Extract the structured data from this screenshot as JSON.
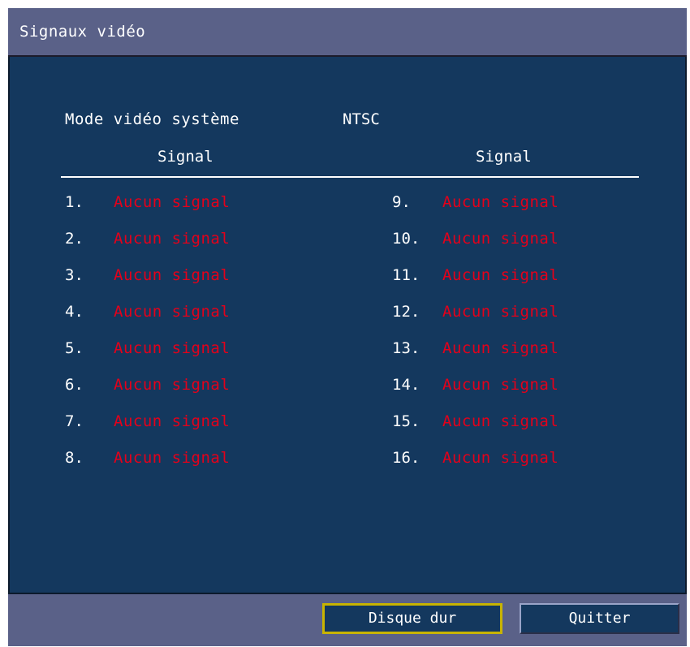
{
  "window": {
    "title": "Signaux vidéo"
  },
  "system": {
    "mode_label": "Mode vidéo système",
    "mode_value": "NTSC"
  },
  "columns": {
    "left_header": "Signal",
    "right_header": "Signal"
  },
  "channels": [
    {
      "num": "1.",
      "status": "Aucun signal"
    },
    {
      "num": "2.",
      "status": "Aucun signal"
    },
    {
      "num": "3.",
      "status": "Aucun signal"
    },
    {
      "num": "4.",
      "status": "Aucun signal"
    },
    {
      "num": "5.",
      "status": "Aucun signal"
    },
    {
      "num": "6.",
      "status": "Aucun signal"
    },
    {
      "num": "7.",
      "status": "Aucun signal"
    },
    {
      "num": "8.",
      "status": "Aucun signal"
    },
    {
      "num": "9.",
      "status": "Aucun signal"
    },
    {
      "num": "10.",
      "status": "Aucun signal"
    },
    {
      "num": "11.",
      "status": "Aucun signal"
    },
    {
      "num": "12.",
      "status": "Aucun signal"
    },
    {
      "num": "13.",
      "status": "Aucun signal"
    },
    {
      "num": "14.",
      "status": "Aucun signal"
    },
    {
      "num": "15.",
      "status": "Aucun signal"
    },
    {
      "num": "16.",
      "status": "Aucun signal"
    }
  ],
  "buttons": {
    "hard_disk": "Disque dur",
    "quit": "Quitter"
  },
  "colors": {
    "panel_bg": "#14385e",
    "frame_bg": "#5a6188",
    "status_no_signal": "#e4001a",
    "selected_button_border": "#c8b400"
  }
}
